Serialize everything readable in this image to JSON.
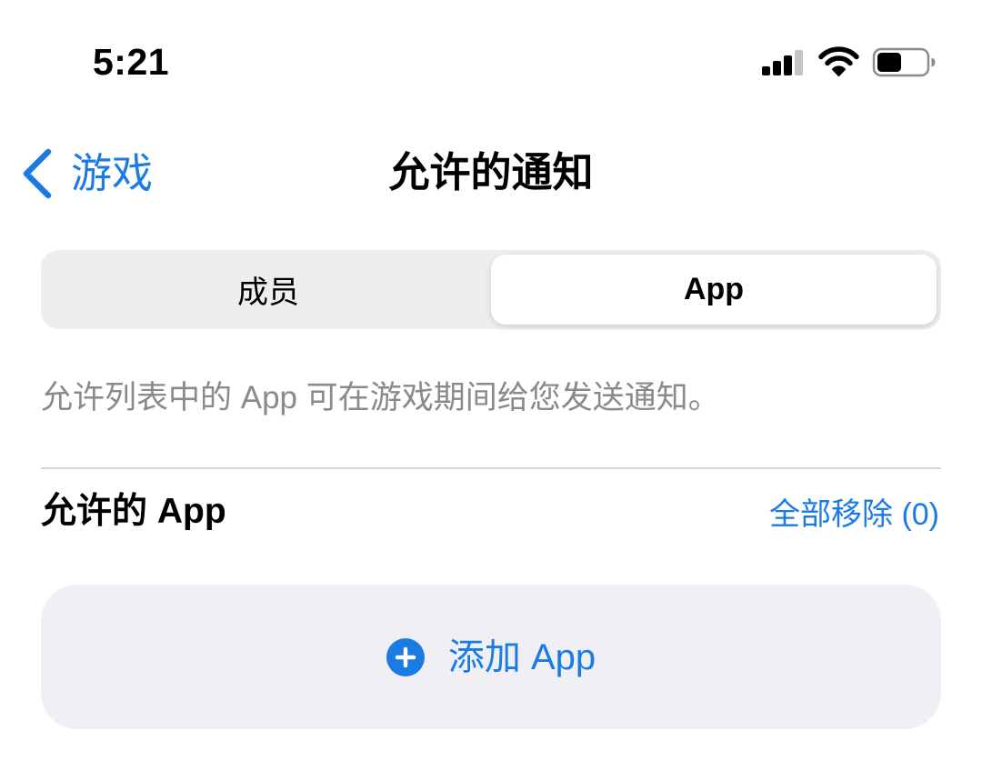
{
  "status_bar": {
    "time": "5:21",
    "icons": [
      "cellular-signal-icon",
      "wifi-icon",
      "battery-icon"
    ],
    "signal_bars": 3,
    "signal_max": 4,
    "battery_level": 0.5
  },
  "nav": {
    "back_icon": "chevron-left-icon",
    "back_label": "游戏",
    "title": "允许的通知"
  },
  "segmented": {
    "options": [
      {
        "label": "成员",
        "selected": false
      },
      {
        "label": "App",
        "selected": true
      }
    ]
  },
  "description": "允许列表中的 App 可在游戏期间给您发送通知。",
  "section": {
    "title": "允许的 App",
    "remove_all_label": "全部移除 (0)"
  },
  "add_button": {
    "icon": "plus-circle-icon",
    "label": "添加 App"
  },
  "colors": {
    "accent": "#1b7be5",
    "background": "#ffffff",
    "secondary_text": "#8a8a8e",
    "grouped_fill": "#f0f0f4",
    "segmented_fill": "#eeeef0"
  }
}
